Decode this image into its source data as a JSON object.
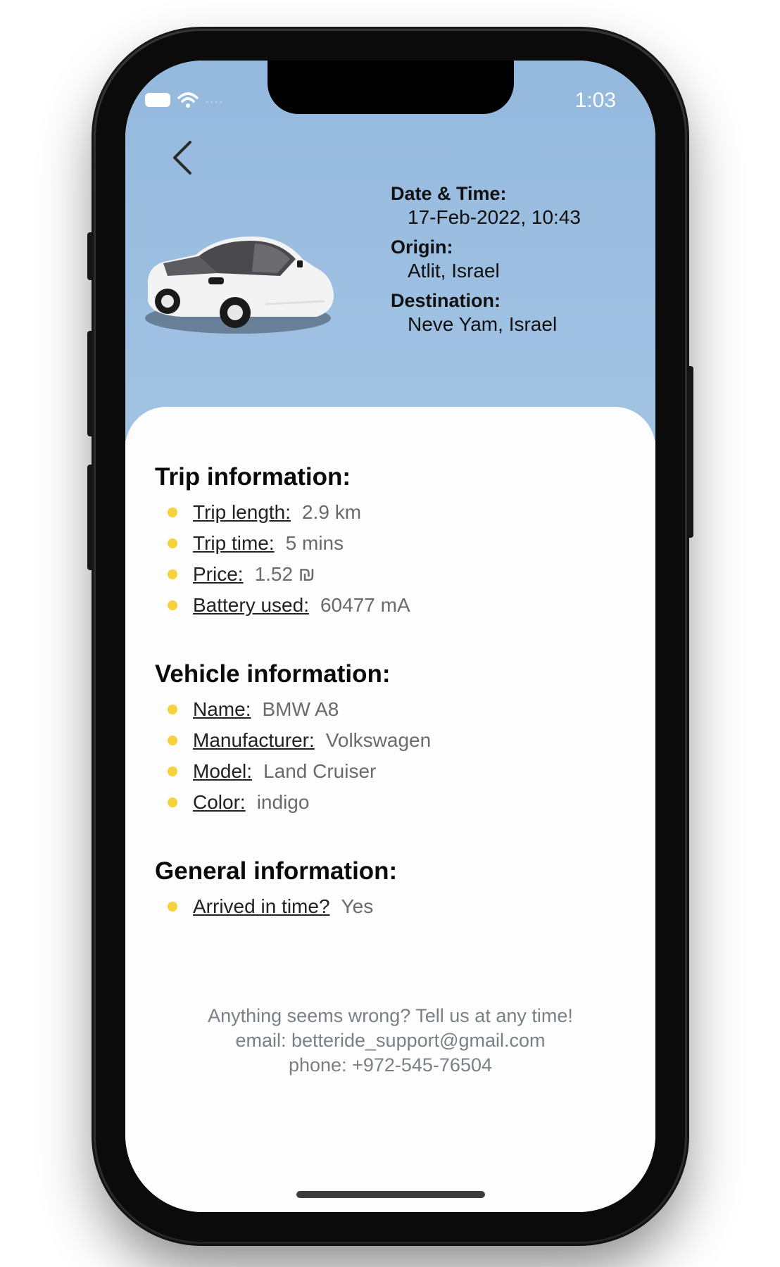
{
  "status_bar": {
    "time": "1:03"
  },
  "header": {
    "date_label": "Date & Time:",
    "date_value": "17-Feb-2022, 10:43",
    "origin_label": "Origin:",
    "origin_value": "Atlit, Israel",
    "destination_label": "Destination:",
    "destination_value": "Neve Yam, Israel",
    "back_icon": "chevron-left-icon",
    "car_image": "white car illustration"
  },
  "trip": {
    "title": "Trip information:",
    "items": [
      {
        "label": "Trip length:",
        "value": "2.9 km"
      },
      {
        "label": "Trip time:",
        "value": "5 mins"
      },
      {
        "label": "Price:",
        "value": "1.52 ₪"
      },
      {
        "label": "Battery used:",
        "value": "60477 mA"
      }
    ]
  },
  "vehicle": {
    "title": "Vehicle information:",
    "items": [
      {
        "label": "Name:",
        "value": "BMW A8"
      },
      {
        "label": "Manufacturer:",
        "value": "Volkswagen"
      },
      {
        "label": "Model:",
        "value": "Land Cruiser"
      },
      {
        "label": "Color:",
        "value": "indigo"
      }
    ]
  },
  "general": {
    "title": "General information:",
    "items": [
      {
        "label": "Arrived in time?",
        "value": "Yes"
      }
    ]
  },
  "footer": {
    "line1": "Anything seems wrong? Tell us at any time!",
    "line2": "email: betteride_support@gmail.com",
    "line3": "phone: +972-545-76504"
  },
  "colors": {
    "header_bg": "#94b9de",
    "bullet": "#f5d23a",
    "footer_text": "#7b7f86"
  }
}
